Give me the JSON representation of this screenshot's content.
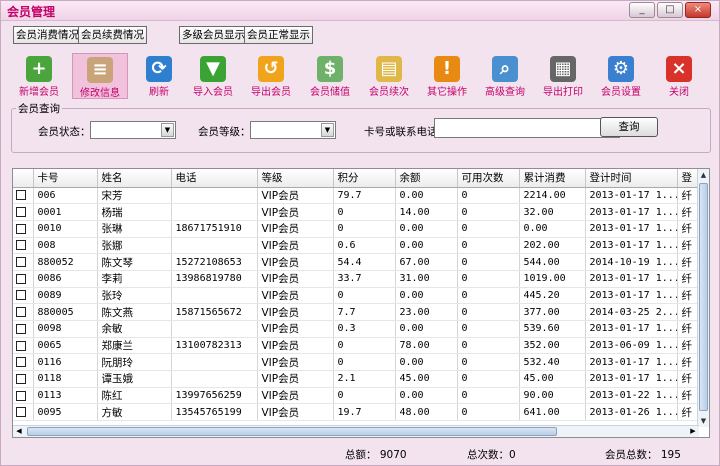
{
  "window": {
    "title": "会员管理",
    "controls": {
      "minimize": "_",
      "maximize": "□",
      "close": "×"
    }
  },
  "top_tabs": [
    "会员消费情况",
    "会员续费情况",
    "多级会员显示",
    "会员正常显示"
  ],
  "toolbar": {
    "items": [
      {
        "label": "新增会员",
        "icon": "add-user-icon",
        "color": "#4aa63c",
        "glyph": "+"
      },
      {
        "label": "修改信息",
        "icon": "edit-doc-icon",
        "color": "#c9a47a",
        "glyph": "≡"
      },
      {
        "label": "刷新",
        "icon": "refresh-icon",
        "color": "#2f7fd0",
        "glyph": "⟳"
      },
      {
        "label": "导入会员",
        "icon": "import-arrow-icon",
        "color": "#3aa334",
        "glyph": "▼"
      },
      {
        "label": "导出会员",
        "icon": "export-icon",
        "color": "#f2a31c",
        "glyph": "↺"
      },
      {
        "label": "会员储值",
        "icon": "coins-icon",
        "color": "#6fb16a",
        "glyph": "$"
      },
      {
        "label": "会员续次",
        "icon": "book-icon",
        "color": "#e0b84a",
        "glyph": "▤"
      },
      {
        "label": "其它操作",
        "icon": "warning-icon",
        "color": "#e88a12",
        "glyph": "!"
      },
      {
        "label": "高级查询",
        "icon": "magnifier-icon",
        "color": "#4a8fd0",
        "glyph": "⌕"
      },
      {
        "label": "导出打印",
        "icon": "printer-icon",
        "color": "#666666",
        "glyph": "▦"
      },
      {
        "label": "会员设置",
        "icon": "settings-icon",
        "color": "#3a7fd0",
        "glyph": "⚙"
      },
      {
        "label": "关闭",
        "icon": "close-circle-icon",
        "color": "#d8322a",
        "glyph": "×"
      }
    ],
    "active_index": 1
  },
  "query": {
    "group_title": "会员查询",
    "status_label": "会员状态：",
    "status_value": "",
    "level_label": "会员等级：",
    "level_value": "",
    "card_label": "卡号或联系电话",
    "card_value": "",
    "search_button": "查询"
  },
  "table": {
    "columns": [
      "卡号",
      "姓名",
      "电话",
      "等级",
      "积分",
      "余额",
      "可用次数",
      "累计消费",
      "登计时间",
      "登"
    ],
    "rows": [
      [
        "006",
        "宋芳",
        "",
        "VIP会员",
        "79.7",
        "0.00",
        "0",
        "2214.00",
        "2013-01-17 1...",
        "纤"
      ],
      [
        "0001",
        "杨瑞",
        "",
        "VIP会员",
        "0",
        "14.00",
        "0",
        "32.00",
        "2013-01-17 1...",
        "纤"
      ],
      [
        "0010",
        "张琳",
        "18671751910",
        "VIP会员",
        "0",
        "0.00",
        "0",
        "0.00",
        "2013-01-17 1...",
        "纤"
      ],
      [
        "008",
        "张娜",
        "",
        "VIP会员",
        "0.6",
        "0.00",
        "0",
        "202.00",
        "2013-01-17 1...",
        "纤"
      ],
      [
        "880052",
        "陈文琴",
        "15272108653",
        "VIP会员",
        "54.4",
        "67.00",
        "0",
        "544.00",
        "2014-10-19 1...",
        "纤"
      ],
      [
        "0086",
        "李莉",
        "13986819780",
        "VIP会员",
        "33.7",
        "31.00",
        "0",
        "1019.00",
        "2013-01-17 1...",
        "纤"
      ],
      [
        "0089",
        "张玲",
        "",
        "VIP会员",
        "0",
        "0.00",
        "0",
        "445.20",
        "2013-01-17 1...",
        "纤"
      ],
      [
        "880005",
        "陈文燕",
        "15871565672",
        "VIP会员",
        "7.7",
        "23.00",
        "0",
        "377.00",
        "2014-03-25 2...",
        "纤"
      ],
      [
        "0098",
        "余敏",
        "",
        "VIP会员",
        "0.3",
        "0.00",
        "0",
        "539.60",
        "2013-01-17 1...",
        "纤"
      ],
      [
        "0065",
        "郑康兰",
        "13100782313",
        "VIP会员",
        "0",
        "78.00",
        "0",
        "352.00",
        "2013-06-09 1...",
        "纤"
      ],
      [
        "0116",
        "阮朋玲",
        "",
        "VIP会员",
        "0",
        "0.00",
        "0",
        "532.40",
        "2013-01-17 1...",
        "纤"
      ],
      [
        "0118",
        "谭玉娥",
        "",
        "VIP会员",
        "2.1",
        "45.00",
        "0",
        "45.00",
        "2013-01-17 1...",
        "纤"
      ],
      [
        "0113",
        "陈红",
        "13997656259",
        "VIP会员",
        "0",
        "0.00",
        "0",
        "90.00",
        "2013-01-22 1...",
        "纤"
      ],
      [
        "0095",
        "方敏",
        "13545765199",
        "VIP会员",
        "19.7",
        "48.00",
        "0",
        "641.00",
        "2013-01-26 1...",
        "纤"
      ]
    ]
  },
  "status": {
    "total_amount": "总额： 9070",
    "total_times": "总次数：0",
    "member_count": "会员总数： 195"
  },
  "colors": {
    "accent": "#c4006a",
    "background": "#f3e3ef"
  }
}
